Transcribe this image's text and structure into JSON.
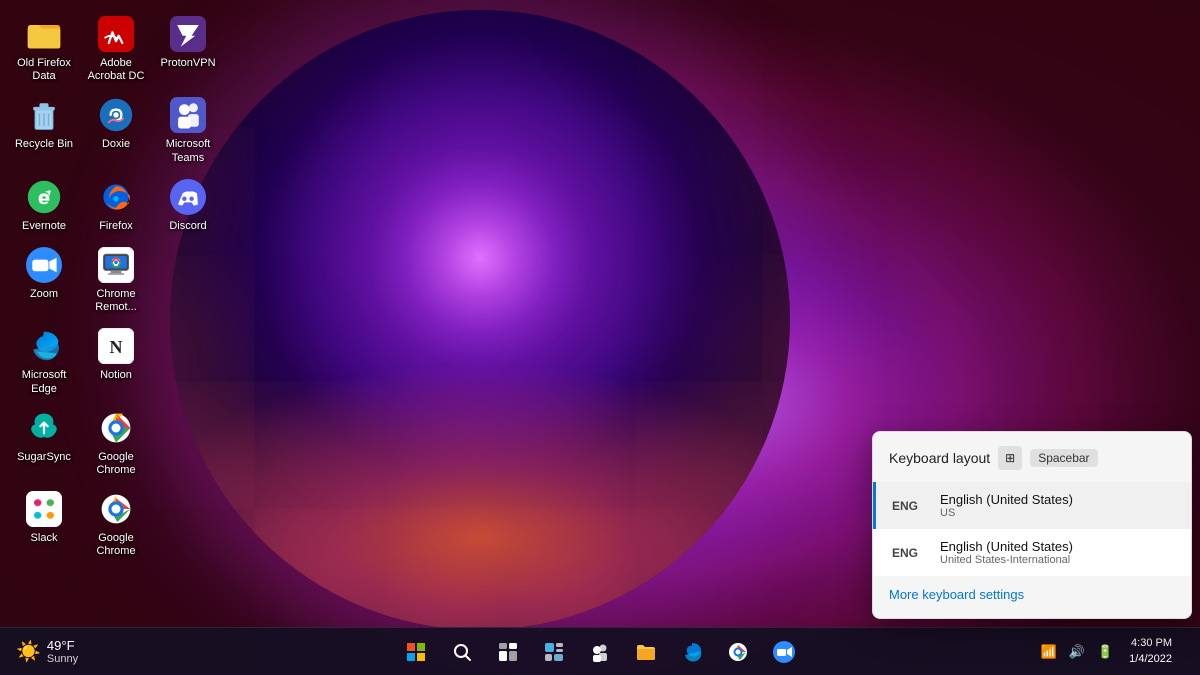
{
  "desktop": {
    "icons": [
      {
        "id": "old-firefox-data",
        "label": "Old Firefox\nData",
        "color": "#f5a623",
        "type": "folder-yellow"
      },
      {
        "id": "adobe-acrobat",
        "label": "Adobe\nAcrobat DC",
        "color": "#cc0000",
        "type": "adobe"
      },
      {
        "id": "protonvpn",
        "label": "ProtonVPN",
        "color": "#5a2d8b",
        "type": "proton"
      },
      {
        "id": "recycle-bin",
        "label": "Recycle Bin",
        "color": "#888",
        "type": "recycle"
      },
      {
        "id": "doxie",
        "label": "Doxie",
        "color": "#1a6fbd",
        "type": "doxie"
      },
      {
        "id": "microsoft-teams",
        "label": "Microsoft\nTeams",
        "color": "#5059c9",
        "type": "teams"
      },
      {
        "id": "evernote",
        "label": "Evernote",
        "color": "#2dbe60",
        "type": "evernote"
      },
      {
        "id": "firefox",
        "label": "Firefox",
        "color": "#ff6611",
        "type": "firefox"
      },
      {
        "id": "discord",
        "label": "Discord",
        "color": "#5865f2",
        "type": "discord"
      },
      {
        "id": "zoom",
        "label": "Zoom",
        "color": "#2d8cff",
        "type": "zoom"
      },
      {
        "id": "chrome-remote",
        "label": "Chrome\nRemot...",
        "color": "#fff",
        "type": "chrome-remote"
      },
      {
        "id": "microsoft-edge",
        "label": "Microsoft\nEdge",
        "color": "#0078d4",
        "type": "edge"
      },
      {
        "id": "notion",
        "label": "Notion",
        "color": "#fff",
        "type": "notion"
      },
      {
        "id": "sugarsync",
        "label": "SugarSync",
        "color": "#00a86b",
        "type": "sugarsync"
      },
      {
        "id": "google-chrome-1",
        "label": "Google\nChrome",
        "color": "#4285f4",
        "type": "chrome"
      },
      {
        "id": "slack",
        "label": "Slack",
        "color": "#4a154b",
        "type": "slack"
      },
      {
        "id": "google-chrome-2",
        "label": "Google\nChrome",
        "color": "#4285f4",
        "type": "chrome"
      }
    ]
  },
  "taskbar": {
    "weather": {
      "icon": "☀️",
      "temperature": "49°F",
      "condition": "Sunny"
    },
    "buttons": [
      {
        "id": "start",
        "label": "Start"
      },
      {
        "id": "search",
        "label": "Search"
      },
      {
        "id": "taskview",
        "label": "Task View"
      },
      {
        "id": "widgets",
        "label": "Widgets"
      },
      {
        "id": "teams-taskbar",
        "label": "Teams"
      },
      {
        "id": "explorer",
        "label": "File Explorer"
      },
      {
        "id": "edge-taskbar",
        "label": "Microsoft Edge"
      },
      {
        "id": "chrome-taskbar",
        "label": "Google Chrome"
      },
      {
        "id": "zoom-taskbar",
        "label": "Zoom"
      }
    ],
    "clock": {
      "time": "4:30 PM",
      "date": "1/4/2022"
    }
  },
  "keyboard_popup": {
    "title": "Keyboard layout",
    "shortcut": "Spacebar",
    "items": [
      {
        "id": "eng-us",
        "badge": "ENG",
        "name": "English (United States)",
        "sub": "US",
        "selected": true
      },
      {
        "id": "eng-intl",
        "badge": "ENG",
        "name": "English (United States)",
        "sub": "United States-International",
        "selected": false
      }
    ],
    "footer_link": "More keyboard settings"
  }
}
